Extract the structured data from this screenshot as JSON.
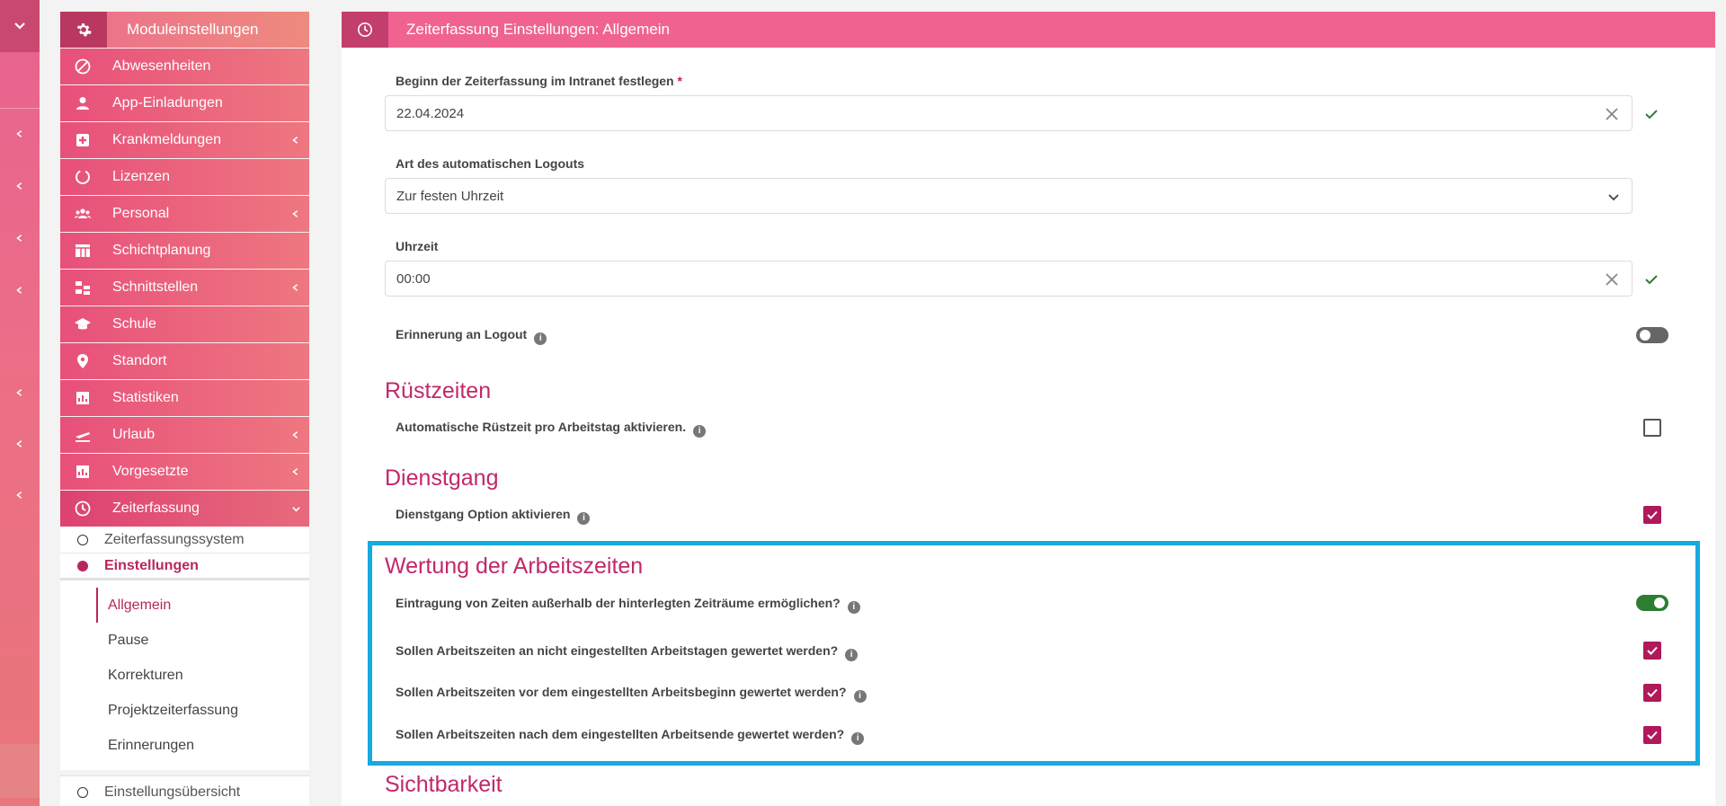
{
  "rail": {
    "icons": [
      "chevron-down-icon",
      "chevron-left-icon"
    ]
  },
  "sidebar": {
    "header": {
      "title": "Moduleinstellungen",
      "icon": "gear-icon"
    },
    "items": [
      {
        "label": "Abwesenheiten",
        "icon": "block-icon",
        "chevron": false
      },
      {
        "label": "App-Einladungen",
        "icon": "person-icon",
        "chevron": false
      },
      {
        "label": "Krankmeldungen",
        "icon": "medical-icon",
        "chevron": true
      },
      {
        "label": "Lizenzen",
        "icon": "circle-progress-icon",
        "chevron": false
      },
      {
        "label": "Personal",
        "icon": "group-icon",
        "chevron": true
      },
      {
        "label": "Schichtplanung",
        "icon": "table-icon",
        "chevron": false
      },
      {
        "label": "Schnittstellen",
        "icon": "hierarchy-icon",
        "chevron": true
      },
      {
        "label": "Schule",
        "icon": "school-icon",
        "chevron": false
      },
      {
        "label": "Standort",
        "icon": "location-icon",
        "chevron": false
      },
      {
        "label": "Statistiken",
        "icon": "stats-icon",
        "chevron": false
      },
      {
        "label": "Urlaub",
        "icon": "flight-icon",
        "chevron": true
      },
      {
        "label": "Vorgesetzte",
        "icon": "stats-icon",
        "chevron": true
      },
      {
        "label": "Zeiterfassung",
        "icon": "clock-icon",
        "chevron": "down"
      }
    ],
    "sub_items": [
      {
        "label": "Zeiterfassungssystem",
        "active": false
      },
      {
        "label": "Einstellungen",
        "active": true
      }
    ],
    "tree": [
      {
        "label": "Allgemein",
        "active": true
      },
      {
        "label": "Pause",
        "active": false
      },
      {
        "label": "Korrekturen",
        "active": false
      },
      {
        "label": "Projektzeiterfassung",
        "active": false
      },
      {
        "label": "Erinnerungen",
        "active": false
      }
    ],
    "overview": "Einstellungsübersicht"
  },
  "main": {
    "header": {
      "title": "Zeiterfassung Einstellungen: Allgemein",
      "icon": "clock-icon"
    },
    "start_date": {
      "label": "Beginn der Zeiterfassung im Intranet festlegen",
      "required_mark": "*",
      "value": "22.04.2024"
    },
    "logout_type": {
      "label": "Art des automatischen Logouts",
      "value": "Zur festen Uhrzeit"
    },
    "time": {
      "label": "Uhrzeit",
      "value": "00:00"
    },
    "logout_reminder": {
      "label": "Erinnerung an Logout",
      "enabled": false
    },
    "sections": {
      "ruestzeiten": {
        "title": "Rüstzeiten",
        "auto": {
          "label": "Automatische Rüstzeit pro Arbeitstag aktivieren.",
          "checked": false
        }
      },
      "dienstgang": {
        "title": "Dienstgang",
        "option": {
          "label": "Dienstgang Option aktivieren",
          "checked": true
        }
      },
      "wertung": {
        "title": "Wertung der Arbeitszeiten",
        "outside": {
          "label": "Eintragung von Zeiten außerhalb der hinterlegten Zeiträume ermöglichen?",
          "enabled": true
        },
        "non_workdays": {
          "label": "Sollen Arbeitszeiten an nicht eingestellten Arbeitstagen gewertet werden?",
          "checked": true
        },
        "before_start": {
          "label": "Sollen Arbeitszeiten vor dem eingestellten Arbeitsbeginn gewertet werden?",
          "checked": true
        },
        "after_end": {
          "label": "Sollen Arbeitszeiten nach dem eingestellten Arbeitsende gewertet werden?",
          "checked": true
        }
      },
      "sichtbarkeit": {
        "title": "Sichtbarkeit"
      }
    },
    "info_glyph": "i"
  },
  "colors": {
    "accent": "#c2286a",
    "header": "#f06391",
    "highlight": "#17a9e1",
    "check_ok": "#2e7d32",
    "checkbox": "#b0195a"
  }
}
